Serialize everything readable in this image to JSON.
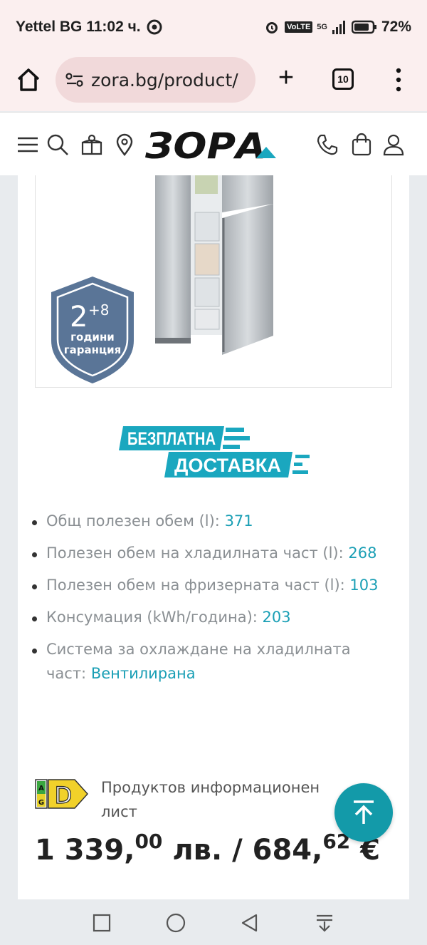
{
  "status_bar": {
    "carrier_time": "Yettel BG 11:02 ч.",
    "volte": "VoLTE",
    "network": "5G",
    "battery": "72%"
  },
  "browser": {
    "url": "zora.bg/product/",
    "tab_count": "10"
  },
  "site": {
    "logo_text": "ЗОРА"
  },
  "product": {
    "warranty_badge": {
      "base": "2",
      "extra": "+8",
      "line1": "години",
      "line2": "гаранция"
    },
    "delivery_banner": {
      "line1": "БЕЗПЛАТНА",
      "line2": "ДОСТАВКА"
    },
    "specs": [
      {
        "label": "Общ полезен обем (l): ",
        "value": "371"
      },
      {
        "label": "Полезен обем на хладилната част (l): ",
        "value": "268"
      },
      {
        "label": "Полезен обем на фризерната част (l): ",
        "value": "103"
      },
      {
        "label": "Консумация (kWh/година): ",
        "value": "203"
      },
      {
        "label": "Система за охлаждане на хладилната част: ",
        "value": "Вентилирана"
      }
    ],
    "energy_label": {
      "top": "A",
      "bottom": "G",
      "class": "D"
    },
    "info_sheet_link": "Продуктов информационен лист",
    "price": {
      "bgn_whole": "1 339,",
      "bgn_cents": "00",
      "bgn_unit": " лв. / ",
      "eur_whole": "684,",
      "eur_cents": "62",
      "eur_unit": " €"
    }
  },
  "colors": {
    "accent": "#1a9fb5",
    "badge": "#5a7597",
    "browser_bg": "#fbefef"
  }
}
